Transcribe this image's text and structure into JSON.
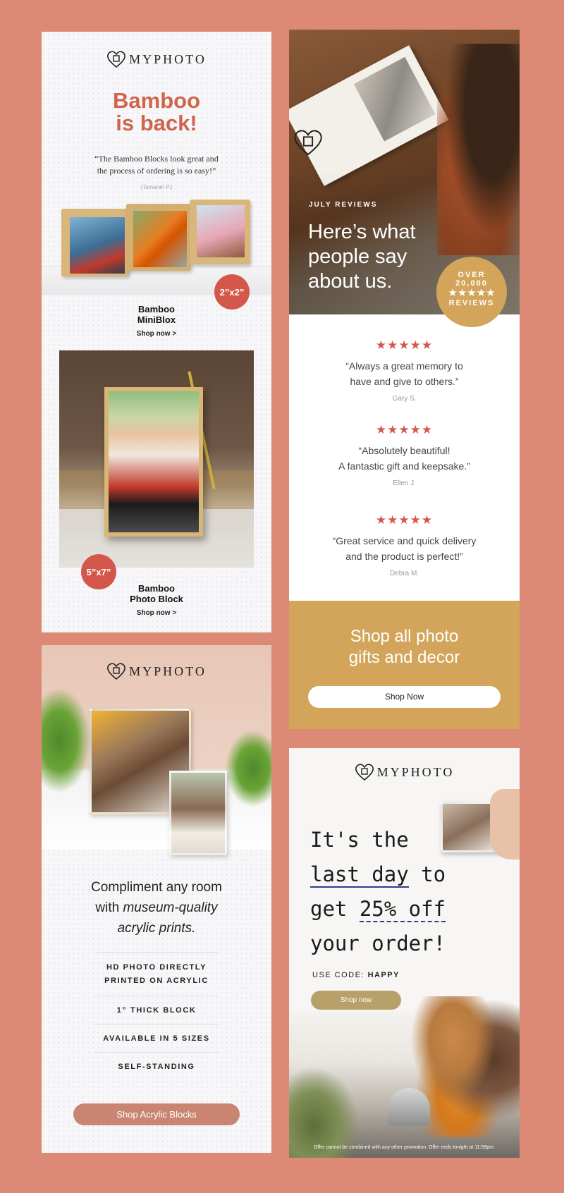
{
  "brand": "MyPhoto",
  "colors": {
    "background": "#dc8a75",
    "accent_red": "#d4574b",
    "gold": "#d2a55a",
    "pill_brown": "#b8a06a",
    "rose": "#c98572"
  },
  "panel1": {
    "headline_1": "Bamboo",
    "headline_2": "is back!",
    "quote_1": "“The Bamboo Blocks look great and",
    "quote_2": "the process of ordering is so easy!”",
    "author": "(Tamarah P.)",
    "badge_small": "2”x2”",
    "product1_line1": "Bamboo",
    "product1_line2": "MiniBlox",
    "product1_cta": "Shop now >",
    "badge_large": "5”x7”",
    "product2_line1": "Bamboo",
    "product2_line2": "Photo Block",
    "product2_cta": "Shop now >"
  },
  "panel2": {
    "eyebrow": "JULY REVIEWS",
    "hero_1": "Here’s what",
    "hero_2": "people say",
    "hero_3": "about us.",
    "badge_over": "OVER",
    "badge_count": "20,000",
    "badge_stars": "★★★★★",
    "badge_reviews": "REVIEWS",
    "reviews": [
      {
        "stars": "★★★★★",
        "line1": "“Always a great memory to",
        "line2": "have and give to others.”",
        "author": "Gary S."
      },
      {
        "stars": "★★★★★",
        "line1": "“Absolutely beautiful!",
        "line2": "A fantastic gift and keepsake.”",
        "author": "Ellen J."
      },
      {
        "stars": "★★★★★",
        "line1": "“Great service and quick delivery",
        "line2": "and the product is perfect!”",
        "author": "Debra M."
      }
    ],
    "footer_1": "Shop all photo",
    "footer_2": "gifts and decor",
    "cta": "Shop Now"
  },
  "panel3": {
    "headline_1": "Compliment any room",
    "headline_2a": "with ",
    "headline_2b": "museum-quality",
    "headline_3": "acrylic prints.",
    "features": [
      {
        "line1": "HD PHOTO DIRECTLY",
        "line2": "PRINTED ON ACRYLIC"
      },
      {
        "line1": "1” THICK BLOCK",
        "line2": ""
      },
      {
        "line1": "AVAILABLE IN 5 SIZES",
        "line2": ""
      },
      {
        "line1": "SELF-STANDING",
        "line2": ""
      }
    ],
    "cta": "Shop Acrylic Blocks"
  },
  "panel4": {
    "hand_1": "It's the",
    "hand_2a": "last day",
    "hand_2b": " to",
    "hand_3a": "get ",
    "hand_3b": "25% off",
    "hand_4": "your order!",
    "code_label": "USE CODE: ",
    "code": "HAPPY",
    "cta": "Shop now",
    "fine_print": "Offer cannot be combined with any other promotion. Offer ends tonight at 11:59pm."
  },
  "icons": [
    "heart-frame-logo-icon",
    "star-icon"
  ]
}
